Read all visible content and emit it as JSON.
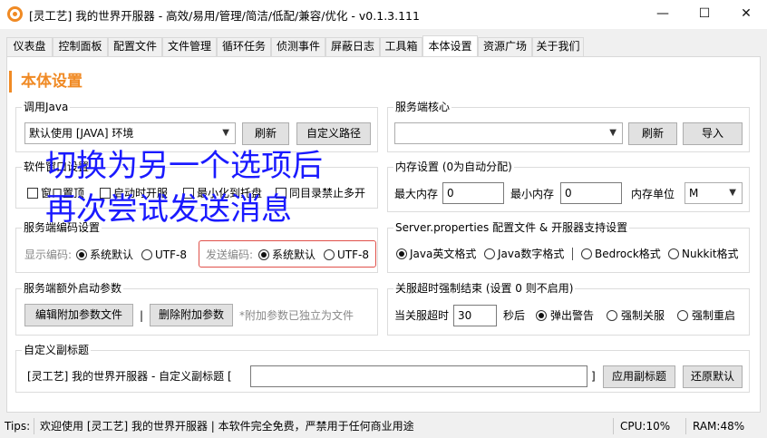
{
  "window": {
    "title": "[灵工艺] 我的世界开服器 - 高效/易用/管理/简洁/低配/兼容/优化 - v0.1.3.111",
    "minimize": "—",
    "maximize": "☐",
    "close": "✕"
  },
  "tabs": [
    "仪表盘",
    "控制面板",
    "配置文件",
    "文件管理",
    "循环任务",
    "侦测事件",
    "屏蔽日志",
    "工具箱",
    "本体设置",
    "资源广场",
    "关于我们"
  ],
  "page": {
    "title": "本体设置"
  },
  "java": {
    "group": "调用Java",
    "selected": "默认使用 [JAVA] 环境",
    "refresh": "刷新",
    "custom_path": "自定义路径"
  },
  "core": {
    "group": "服务端核心",
    "selected": "",
    "refresh": "刷新",
    "import": "导入"
  },
  "window_settings": {
    "group": "软件窗口设置",
    "opt1": "窗口置顶",
    "opt2": "启动时开服",
    "opt3": "最小化到托盘",
    "opt4": "同目录禁止多开"
  },
  "memory": {
    "group": "内存设置 (0为自动分配)",
    "max_label": "最大内存",
    "max_value": "0",
    "min_label": "最小内存",
    "min_value": "0",
    "unit_label": "内存单位",
    "unit_value": "M"
  },
  "encoding": {
    "group": "服务端编码设置",
    "display_label": "显示编码:",
    "display_opt1": "系统默认",
    "display_opt2": "UTF-8",
    "send_label": "发送编码:",
    "send_opt1": "系统默认",
    "send_opt2": "UTF-8"
  },
  "props": {
    "group": "Server.properties 配置文件 & 开服器支持设置",
    "opt1": "Java英文格式",
    "opt2": "Java数字格式",
    "opt3": "Bedrock格式",
    "opt4": "Nukkit格式"
  },
  "extra": {
    "group": "服务端额外启动参数",
    "edit": "编辑附加参数文件",
    "sep": "|",
    "delete": "删除附加参数",
    "note": "*附加参数已独立为文件"
  },
  "timeout": {
    "group": "关服超时强制结束 (设置 0 则不启用)",
    "label": "当关服超时",
    "value": "30",
    "unit": "秒后",
    "opt1": "弹出警告",
    "opt2": "强制关服",
    "opt3": "强制重启"
  },
  "subtitle": {
    "group": "自定义副标题",
    "prefix": "[灵工艺] 我的世界开服器 - 自定义副标题 [",
    "value": "",
    "suffix": "]",
    "apply": "应用副标题",
    "restore": "还原默认"
  },
  "overlay": {
    "line1": "切换为另一个选项后",
    "line2": "再次尝试发送消息"
  },
  "status": {
    "tips_label": "Tips:",
    "tips_text": "欢迎使用 [灵工艺] 我的世界开服器 | 本软件完全免费，严禁用于任何商业用途",
    "cpu": "CPU:10%",
    "ram": "RAM:48%"
  },
  "colors": {
    "accent": "#f08a24",
    "overlay": "#1a1aff",
    "highlight": "#e0504a"
  }
}
